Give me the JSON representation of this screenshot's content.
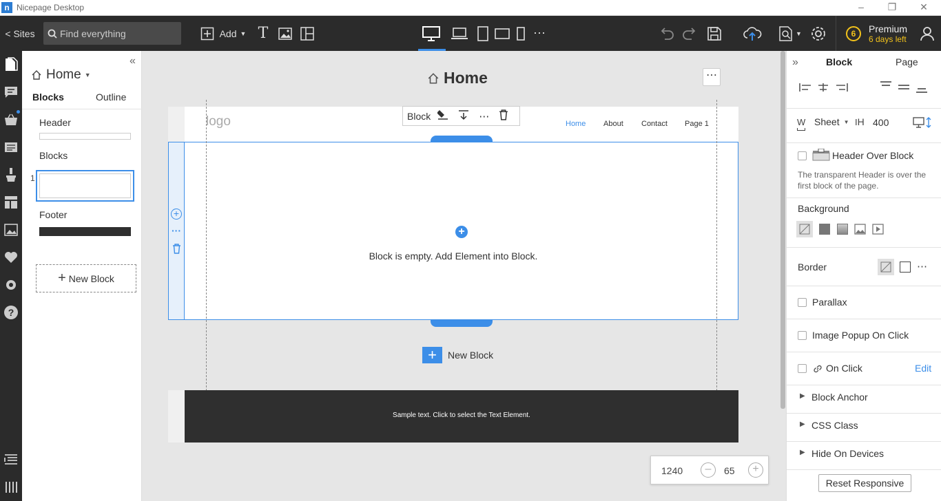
{
  "titlebar": {
    "app_icon": "n",
    "title": "Nicepage Desktop"
  },
  "toolbar": {
    "sites": "< Sites",
    "search_placeholder": "Find everything",
    "add": "Add",
    "premium_count": "6",
    "premium": "Premium",
    "days_left": "6 days left"
  },
  "left_panel": {
    "page_title": "Home",
    "tabs": [
      "Blocks",
      "Outline"
    ],
    "header_label": "Header",
    "blocks_label": "Blocks",
    "block_index": "1",
    "footer_label": "Footer",
    "new_block": "New Block"
  },
  "canvas": {
    "page_title": "Home",
    "logo": "logo",
    "nav": [
      "Home",
      "About",
      "Contact",
      "Page 1"
    ],
    "block_toolbar_label": "Block",
    "empty_text": "Block is empty. Add Element into Block.",
    "new_block": "New Block",
    "footer_text": "Sample text. Click to select the Text Element.",
    "zoom_width": "1240",
    "zoom_value": "65"
  },
  "right_panel": {
    "tabs": [
      "Block",
      "Page"
    ],
    "w_label": "W",
    "sheet": "Sheet",
    "h_label": "H",
    "height": "400",
    "header_over_block": "Header Over Block",
    "header_desc": "The transparent Header is over the first block of the page.",
    "background": "Background",
    "border": "Border",
    "parallax": "Parallax",
    "image_popup": "Image Popup On Click",
    "on_click": "On Click",
    "edit": "Edit",
    "block_anchor": "Block Anchor",
    "css_class": "CSS Class",
    "hide_on_devices": "Hide On Devices",
    "reset": "Reset Responsive"
  },
  "colors": {
    "accent": "#3c8ee8",
    "dark": "#2b2b2b",
    "premium": "#f2c21b"
  }
}
